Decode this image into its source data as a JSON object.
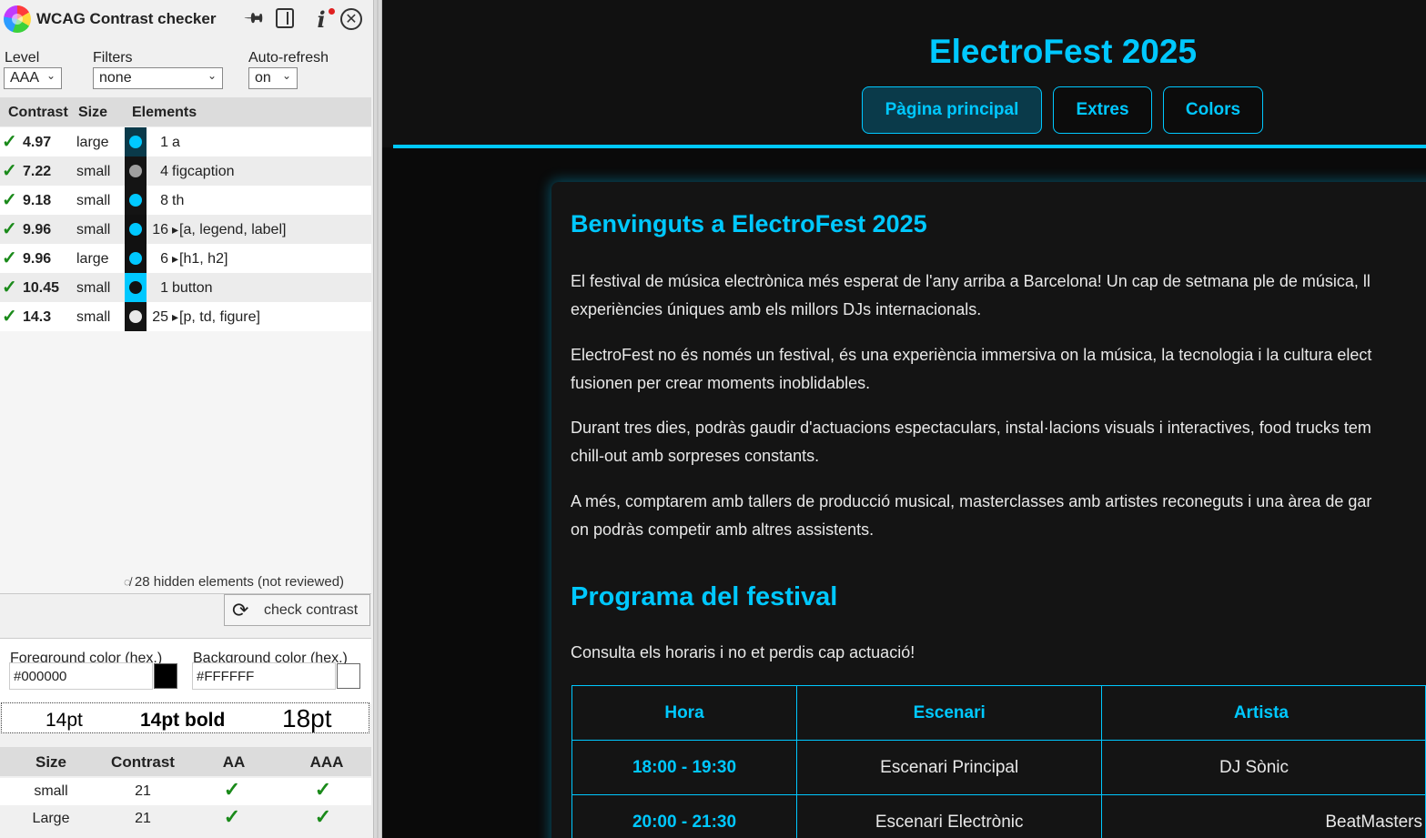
{
  "panel": {
    "title": "WCAG Contrast checker",
    "level": {
      "label": "Level",
      "value": "AAA"
    },
    "filters": {
      "label": "Filters",
      "value": "none"
    },
    "autorefresh": {
      "label": "Auto-refresh",
      "value": "on"
    },
    "headers": {
      "contrast": "Contrast",
      "size": "Size",
      "elements": "Elements"
    },
    "rows": [
      {
        "ratio": "4.97",
        "size": "large",
        "count": "1",
        "elements": "a",
        "fg": "#00c8ff",
        "bg": "#0a3a4a",
        "expand": false
      },
      {
        "ratio": "7.22",
        "size": "small",
        "count": "4",
        "elements": "figcaption",
        "fg": "#a0a0a0",
        "bg": "#141414",
        "expand": false
      },
      {
        "ratio": "9.18",
        "size": "small",
        "count": "8",
        "elements": "th",
        "fg": "#00c8ff",
        "bg": "#141414",
        "expand": false
      },
      {
        "ratio": "9.96",
        "size": "small",
        "count": "16",
        "elements": "[a, legend, label]",
        "fg": "#00c8ff",
        "bg": "#111111",
        "expand": true
      },
      {
        "ratio": "9.96",
        "size": "large",
        "count": "6",
        "elements": "[h1, h2]",
        "fg": "#00c8ff",
        "bg": "#111111",
        "expand": true
      },
      {
        "ratio": "10.45",
        "size": "small",
        "count": "1",
        "elements": "button",
        "fg": "#111111",
        "bg": "#00c8ff",
        "expand": false
      },
      {
        "ratio": "14.3",
        "size": "small",
        "count": "25",
        "elements": "[p, td, figure]",
        "fg": "#e8e8e8",
        "bg": "#141414",
        "expand": true
      }
    ],
    "hidden_note": "28 hidden elements (not reviewed)",
    "check_button": "check contrast",
    "foreground": {
      "label": "Foreground color (hex.)",
      "value": "#000000",
      "swatch": "#000000"
    },
    "background": {
      "label": "Background color (hex.)",
      "value": "#FFFFFF",
      "swatch": "#FFFFFF"
    },
    "preview": {
      "normal": "14pt",
      "bold": "14pt bold",
      "large": "18pt"
    },
    "result_headers": {
      "size": "Size",
      "contrast": "Contrast",
      "aa": "AA",
      "aaa": "AAA"
    },
    "results": [
      {
        "size": "small",
        "contrast": "21",
        "aa": "✓",
        "aaa": "✓"
      },
      {
        "size": "Large",
        "contrast": "21",
        "aa": "✓",
        "aaa": "✓"
      }
    ]
  },
  "site": {
    "title": "ElectroFest 2025",
    "nav": [
      "Pàgina principal",
      "Extres",
      "Colors"
    ],
    "welcome_heading": "Benvinguts a ElectroFest 2025",
    "paragraphs": [
      [
        "El festival de música electrònica més esperat de l'any arriba a Barcelona! Un cap de setmana ple de música, ll",
        "experiències úniques amb els millors DJs internacionals."
      ],
      [
        "ElectroFest no és només un festival, és una experiència immersiva on la música, la tecnologia i la cultura elect",
        "fusionen per crear moments inoblidables."
      ],
      [
        "Durant tres dies, podràs gaudir d'actuacions espectaculars, instal·lacions visuals i interactives, food trucks tem",
        "chill-out amb sorpreses constants."
      ],
      [
        "A més, comptarem amb tallers de producció musical, masterclasses amb artistes reconeguts i una àrea de gar",
        "on podràs competir amb altres assistents."
      ]
    ],
    "program_heading": "Programa del festival",
    "program_intro": "Consulta els horaris i no et perdis cap actuació!",
    "table": {
      "headers": [
        "Hora",
        "Escenari",
        "Artista"
      ],
      "rows": [
        [
          "18:00 - 19:30",
          "Escenari Principal",
          "DJ Sònic"
        ],
        [
          "20:00 - 21:30",
          "Escenari Electrònic",
          "BeatMasters"
        ]
      ]
    }
  }
}
